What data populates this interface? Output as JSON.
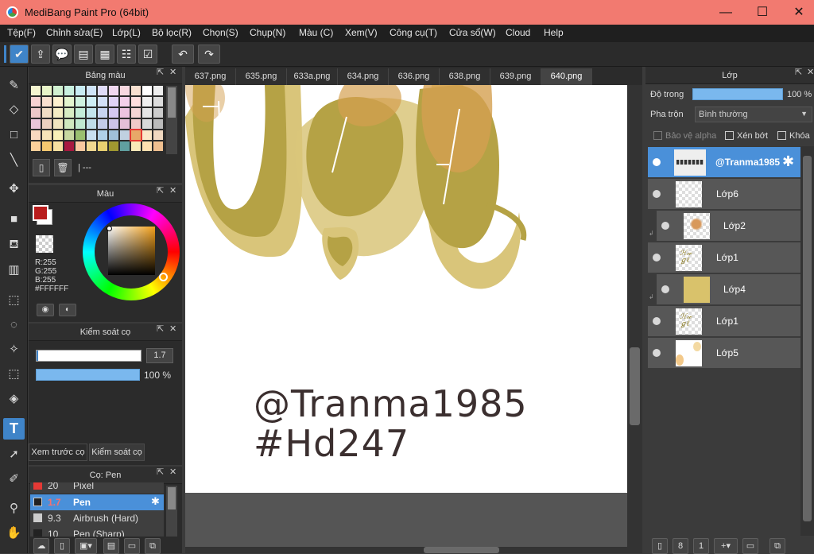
{
  "window": {
    "title": "MediBang Paint Pro (64bit)",
    "minimize": "—",
    "maximize": "☐",
    "close": "✕"
  },
  "menu": [
    "Tệp(F)",
    "Chỉnh sửa(E)",
    "Lớp(L)",
    "Bộ lọc(R)",
    "Chọn(S)",
    "Chụp(N)",
    "Màu (C)",
    "Xem(V)",
    "Công cụ(T)",
    "Cửa sổ(W)",
    "Cloud",
    "Help"
  ],
  "toolbar": {
    "icons": [
      "check-icon",
      "share-icon",
      "comment-icon",
      "chat-icon",
      "document-icon",
      "list-icon",
      "checklist-icon",
      "undo-icon",
      "redo-icon"
    ],
    "glyphs": [
      "✔",
      "⇪",
      "💬",
      "▤",
      "▦",
      "☷",
      "☑",
      "↶",
      "↷"
    ]
  },
  "tabs": [
    "637.png",
    "635.png",
    "633a.png",
    "634.png",
    "636.png",
    "638.png",
    "639.png",
    "640.png"
  ],
  "active_tab": "640.png",
  "palette_panel": {
    "title": "Bảng màu",
    "footer_text": "| ---"
  },
  "color_panel": {
    "title": "Màu",
    "r": "R:255",
    "g": "G:255",
    "b": "B:255",
    "hex": "#FFFFFF",
    "main_color": "#b91c1c",
    "sub_color": "#ffffff"
  },
  "brush_control": {
    "title": "Kiểm soát cọ",
    "size": "1.7",
    "opacity": "100 %",
    "tab_preview": "Xem trước cọ",
    "tab_control": "Kiểm soát cọ"
  },
  "brush_list": {
    "title": "Cọ: Pen",
    "items": [
      {
        "size": "20",
        "name": "Pixel",
        "color": "#e53935",
        "selected": false
      },
      {
        "size": "1.7",
        "name": "Pen",
        "color": "#222222",
        "selected": true
      },
      {
        "size": "9.3",
        "name": "Airbrush (Hard)",
        "color": "#cccccc",
        "selected": false
      },
      {
        "size": "10",
        "name": "Pen (Sharp)",
        "color": "#222222",
        "selected": false
      }
    ]
  },
  "canvas": {
    "line1": "@Tranma1985",
    "line2": "#Hd247"
  },
  "layers_panel": {
    "title": "Lớp",
    "opacity_label": "Độ trong",
    "opacity_value": "100 %",
    "blend_label": "Pha trộn",
    "blend_value": "Bình thường",
    "protect_alpha": "Bảo vệ alpha",
    "clip": "Xén bớt",
    "lock": "Khóa",
    "layers": [
      {
        "name": "@Tranma1985",
        "selected": true
      },
      {
        "name": "Lớp6",
        "selected": false
      },
      {
        "name": "Lớp2",
        "selected": false
      },
      {
        "name": "Lớp1",
        "selected": false
      },
      {
        "name": "Lớp4",
        "selected": false
      },
      {
        "name": "Lớp1",
        "selected": false
      },
      {
        "name": "Lớp5",
        "selected": false
      }
    ]
  }
}
